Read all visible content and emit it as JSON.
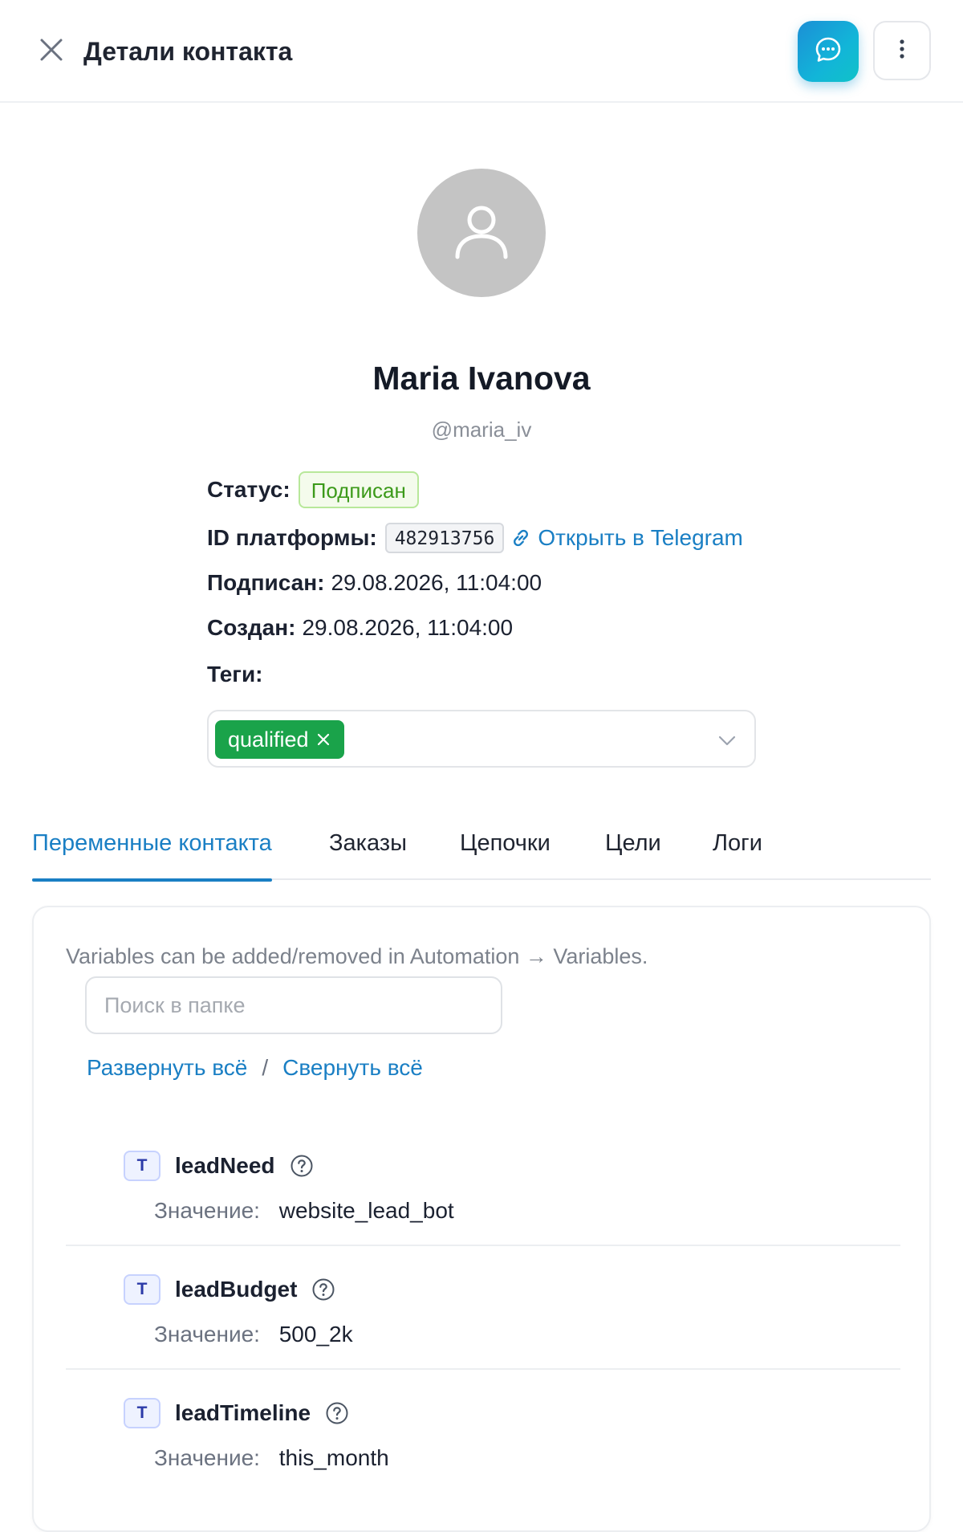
{
  "header": {
    "title": "Детали контакта",
    "close_icon": "close-icon",
    "chat_icon": "chat-bubble-icon",
    "more_icon": "vertical-dots-icon",
    "accent_gradient": [
      "#1c8fd6",
      "#10c2c8"
    ]
  },
  "contact": {
    "avatar_icon": "user-icon",
    "name": "Maria Ivanova",
    "username": "@maria_iv",
    "status_label": "Статус:",
    "status_value": "Подписан",
    "platform_id_label": "ID платформы:",
    "platform_id": "482913756",
    "telegram_link": "Открыть в Telegram",
    "subscribed_label": "Подписан:",
    "subscribed_value": "29.08.2026, 11:04:00",
    "created_label": "Создан:",
    "created_value": "29.08.2026, 11:04:00",
    "tags_label": "Теги:",
    "tags": [
      "qualified"
    ]
  },
  "tabs": [
    {
      "label": "Переменные контакта",
      "active": true
    },
    {
      "label": "Заказы",
      "active": false
    },
    {
      "label": "Цепочки",
      "active": false
    },
    {
      "label": "Цели",
      "active": false
    },
    {
      "label": "Логи",
      "active": false
    }
  ],
  "variables_panel": {
    "hint": "Variables can be added/removed in Automation → Variables.",
    "search_placeholder": "Поиск в папке",
    "search_value": "",
    "expand_all": "Развернуть всё",
    "separator": "/",
    "collapse_all": "Свернуть всё",
    "value_label": "Значение:",
    "items": [
      {
        "type": "T",
        "name": "leadNeed",
        "value": "website_lead_bot"
      },
      {
        "type": "T",
        "name": "leadBudget",
        "value": "500_2k"
      },
      {
        "type": "T",
        "name": "leadTimeline",
        "value": "this_month"
      }
    ]
  },
  "colors": {
    "accent": "#1a7fc4",
    "status_green": "#3c9a1a",
    "tag_green": "#1aa34a",
    "avatar_gray": "#c4c4c4"
  }
}
